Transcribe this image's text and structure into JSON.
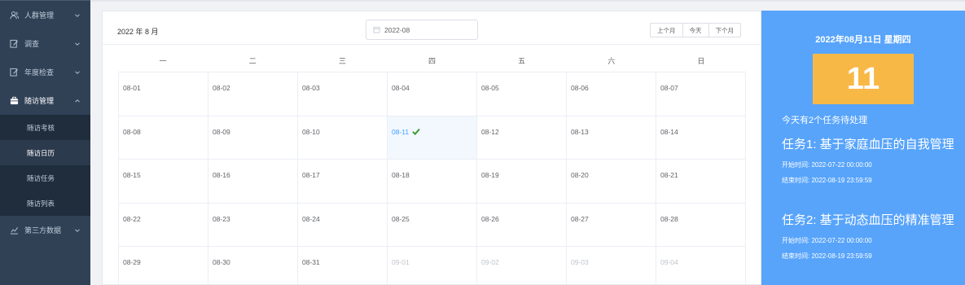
{
  "sidebar": {
    "items": [
      {
        "label": "人群管理",
        "icon": "people-icon"
      },
      {
        "label": "调查",
        "icon": "edit-icon"
      },
      {
        "label": "年度检查",
        "icon": "edit-icon"
      },
      {
        "label": "随访管理",
        "icon": "briefcase-icon",
        "open": true
      },
      {
        "label": "第三方数据",
        "icon": "chart-icon"
      }
    ],
    "submenu": [
      {
        "label": "随访考核"
      },
      {
        "label": "随访日历",
        "active": true
      },
      {
        "label": "随访任务"
      },
      {
        "label": "随访列表"
      }
    ]
  },
  "calendar": {
    "title": "2022 年 8 月",
    "month_value": "2022-08",
    "buttons": {
      "prev": "上个月",
      "today": "今天",
      "next": "下个月"
    },
    "weekdays": [
      "一",
      "二",
      "三",
      "四",
      "五",
      "六",
      "日"
    ],
    "weeks": [
      [
        "08-01",
        "08-02",
        "08-03",
        "08-04",
        "08-05",
        "08-06",
        "08-07"
      ],
      [
        "08-08",
        "08-09",
        "08-10",
        "08-11",
        "08-12",
        "08-13",
        "08-14"
      ],
      [
        "08-15",
        "08-16",
        "08-17",
        "08-18",
        "08-19",
        "08-20",
        "08-21"
      ],
      [
        "08-22",
        "08-23",
        "08-24",
        "08-25",
        "08-26",
        "08-27",
        "08-28"
      ],
      [
        "08-29",
        "08-30",
        "08-31",
        "09-01",
        "09-02",
        "09-03",
        "09-04"
      ]
    ],
    "selected": "08-11",
    "other_month": [
      "09-01",
      "09-02",
      "09-03",
      "09-04"
    ]
  },
  "panel": {
    "date": "2022年08月11日 星期四",
    "day": "11",
    "summary": "今天有2个任务待处理",
    "tasks": [
      {
        "title": "任务1: 基于家庭血压的自我管理",
        "start": "开始时间: 2022-07-22 00:00:00",
        "end": "结束时间: 2022-08-19 23:59:59"
      },
      {
        "title": "任务2: 基于动态血压的精准管理",
        "start": "开始时间: 2022-07-22 00:00:00",
        "end": "结束时间: 2022-08-19 23:59:59"
      }
    ]
  },
  "colors": {
    "sidebar": "#304156",
    "submenu": "#1f2d3d",
    "accent": "#409eff",
    "panel": "#58a4fb",
    "day_box": "#f8b846",
    "check": "#3a9b34"
  }
}
